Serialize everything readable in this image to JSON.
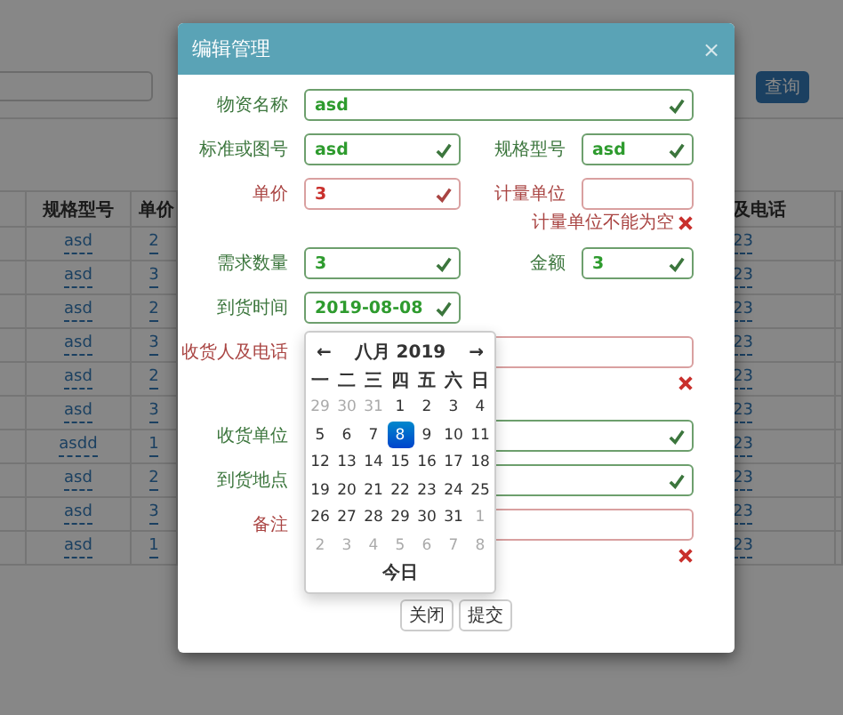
{
  "page": {
    "search_button": "查询",
    "table": {
      "headers": {
        "spec": "规格型号",
        "price": "单价",
        "phone": "及电话"
      },
      "rows": [
        {
          "spec": "asd",
          "price": "2",
          "phone": "23"
        },
        {
          "spec": "asd",
          "price": "3",
          "phone": "23"
        },
        {
          "spec": "asd",
          "price": "2",
          "phone": "23"
        },
        {
          "spec": "asd",
          "price": "3",
          "phone": "23"
        },
        {
          "spec": "asd",
          "price": "2",
          "phone": "23"
        },
        {
          "spec": "asd",
          "price": "3",
          "phone": "23"
        },
        {
          "spec": "asdd",
          "price": "1",
          "phone": "23"
        },
        {
          "spec": "asd",
          "price": "2",
          "phone": "23"
        },
        {
          "spec": "asd",
          "price": "3",
          "phone": "23"
        },
        {
          "spec": "asd",
          "price": "1",
          "phone": "23"
        }
      ]
    }
  },
  "modal": {
    "title": "编辑管理",
    "close": "×",
    "rows": [
      {
        "fields": [
          {
            "label": "物资名称",
            "value": "asd",
            "valid": true,
            "feedback": true,
            "kind": "full"
          }
        ]
      },
      {
        "fields": [
          {
            "label": "标准或图号",
            "value": "asd",
            "valid": true,
            "feedback": true,
            "kind": "half"
          },
          {
            "label": "规格型号",
            "value": "asd",
            "valid": true,
            "feedback": true,
            "kind": "half"
          }
        ]
      },
      {
        "fields": [
          {
            "label": "单价",
            "value": "3",
            "valid": false,
            "feedback": true,
            "kind": "half"
          },
          {
            "label": "计量单位",
            "valid": false,
            "feedback": false,
            "error_text": "计量单位不能为空",
            "kind": "half"
          }
        ]
      },
      {
        "fields": [
          {
            "label": "需求数量",
            "value": "3",
            "valid": true,
            "feedback": true,
            "kind": "half"
          },
          {
            "label": "金额",
            "value": "3",
            "valid": true,
            "feedback": true,
            "kind": "half"
          }
        ]
      },
      {
        "fields": [
          {
            "label": "到货时间",
            "value": "2019-08-08",
            "valid": true,
            "feedback": true,
            "kind": "half",
            "calendar": true
          }
        ]
      },
      {
        "fields": [
          {
            "label": "收货人及电话",
            "valid": false,
            "feedback": false,
            "kind": "full"
          }
        ]
      },
      {
        "fields": [
          {
            "label": "收货单位",
            "valid": true,
            "feedback": true,
            "kind": "full"
          }
        ]
      },
      {
        "fields": [
          {
            "label": "到货地点",
            "valid": true,
            "feedback": true,
            "kind": "full"
          }
        ]
      },
      {
        "fields": [
          {
            "label": "备注",
            "valid": false,
            "feedback": false,
            "kind": "full"
          }
        ]
      }
    ],
    "buttons": [
      "关闭",
      "提交"
    ]
  },
  "calendar": {
    "prev": "←",
    "title": "八月 2019",
    "next": "→",
    "weekdays": [
      "一",
      "二",
      "三",
      "四",
      "五",
      "六",
      "日"
    ],
    "weeks": [
      [
        {
          "day": "29",
          "muted": true,
          "selected": false
        },
        {
          "day": "30",
          "muted": true,
          "selected": false
        },
        {
          "day": "31",
          "muted": true,
          "selected": false
        },
        {
          "day": "1",
          "muted": false,
          "selected": false
        },
        {
          "day": "2",
          "muted": false,
          "selected": false
        },
        {
          "day": "3",
          "muted": false,
          "selected": false
        },
        {
          "day": "4",
          "muted": false,
          "selected": false
        }
      ],
      [
        {
          "day": "5",
          "muted": false,
          "selected": false
        },
        {
          "day": "6",
          "muted": false,
          "selected": false
        },
        {
          "day": "7",
          "muted": false,
          "selected": false
        },
        {
          "day": "8",
          "muted": false,
          "selected": true
        },
        {
          "day": "9",
          "muted": false,
          "selected": false
        },
        {
          "day": "10",
          "muted": false,
          "selected": false
        },
        {
          "day": "11",
          "muted": false,
          "selected": false
        }
      ],
      [
        {
          "day": "12",
          "muted": false,
          "selected": false
        },
        {
          "day": "13",
          "muted": false,
          "selected": false
        },
        {
          "day": "14",
          "muted": false,
          "selected": false
        },
        {
          "day": "15",
          "muted": false,
          "selected": false
        },
        {
          "day": "16",
          "muted": false,
          "selected": false
        },
        {
          "day": "17",
          "muted": false,
          "selected": false
        },
        {
          "day": "18",
          "muted": false,
          "selected": false
        }
      ],
      [
        {
          "day": "19",
          "muted": false,
          "selected": false
        },
        {
          "day": "20",
          "muted": false,
          "selected": false
        },
        {
          "day": "21",
          "muted": false,
          "selected": false
        },
        {
          "day": "22",
          "muted": false,
          "selected": false
        },
        {
          "day": "23",
          "muted": false,
          "selected": false
        },
        {
          "day": "24",
          "muted": false,
          "selected": false
        },
        {
          "day": "25",
          "muted": false,
          "selected": false
        }
      ],
      [
        {
          "day": "26",
          "muted": false,
          "selected": false
        },
        {
          "day": "27",
          "muted": false,
          "selected": false
        },
        {
          "day": "28",
          "muted": false,
          "selected": false
        },
        {
          "day": "29",
          "muted": false,
          "selected": false
        },
        {
          "day": "30",
          "muted": false,
          "selected": false
        },
        {
          "day": "31",
          "muted": false,
          "selected": false
        },
        {
          "day": "1",
          "muted": true,
          "selected": false
        }
      ],
      [
        {
          "day": "2",
          "muted": true,
          "selected": false
        },
        {
          "day": "3",
          "muted": true,
          "selected": false
        },
        {
          "day": "4",
          "muted": true,
          "selected": false
        },
        {
          "day": "5",
          "muted": true,
          "selected": false
        },
        {
          "day": "6",
          "muted": true,
          "selected": false
        },
        {
          "day": "7",
          "muted": true,
          "selected": false
        },
        {
          "day": "8",
          "muted": true,
          "selected": false
        }
      ]
    ],
    "today": "今日"
  }
}
